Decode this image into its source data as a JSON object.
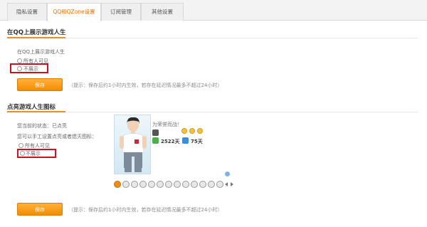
{
  "tabs": [
    "隐私设置",
    "QQ和QZone设置",
    "订阅管理",
    "其他设置"
  ],
  "section1": {
    "title": "在QQ上展示游戏人生",
    "label": "在QQ上展示游戏人生",
    "option1": "所有人可见",
    "option2": "不展示",
    "save": "保存",
    "hint": "（提示：保存后约1小时内生效，若存在延迟情况最多不超过24小时）"
  },
  "section2": {
    "title": "点亮游戏人生图标",
    "status": "您当前的状态：已点亮",
    "manual": "您可以手工设置点亮或者熄灭图标：",
    "option1": "所有人可见",
    "option2": "不展示",
    "save": "保存",
    "hint": "（提示：保存后约1小时内生效，若存在延迟情况最多不超过24小时）",
    "profile": {
      "greeting": "为荣誉而战！",
      "stat1": "2522天",
      "stat2": "75天"
    }
  },
  "colors": {
    "accent": "#f08c1e",
    "highlight": "#c8141e",
    "active_tab": "#e57200"
  }
}
